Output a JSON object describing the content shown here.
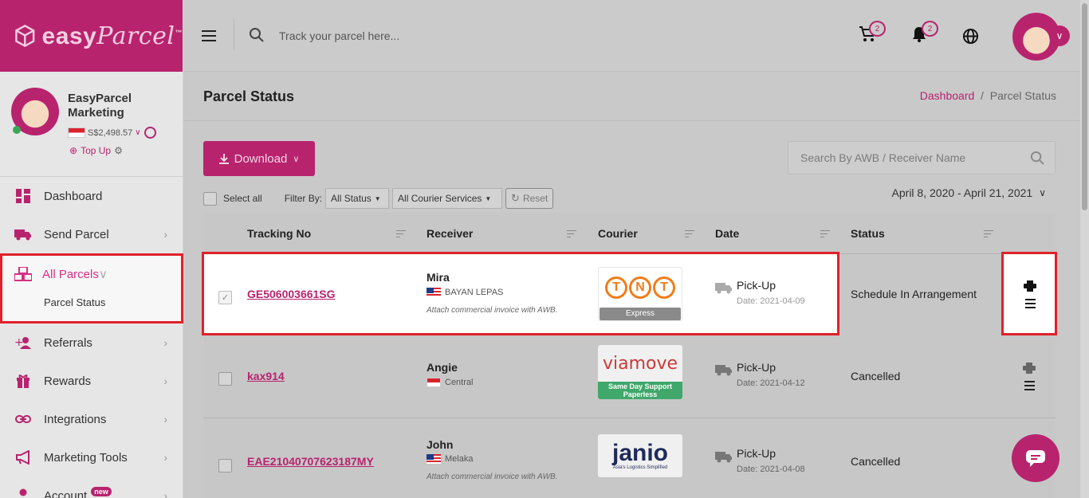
{
  "app": {
    "logo_text": "easy",
    "logo_script": "Parcel",
    "logo_tm": "™"
  },
  "sidebar": {
    "profile": {
      "name": "EasyParcel Marketing",
      "balance": "S$2,498.57",
      "topup_label": "Top Up"
    },
    "items": [
      {
        "label": "Dashboard",
        "icon": "dashboard-icon"
      },
      {
        "label": "Send Parcel",
        "icon": "truck-icon"
      },
      {
        "label": "All Parcels",
        "icon": "boxes-icon",
        "active": true,
        "sub": [
          "Parcel Status"
        ]
      },
      {
        "label": "Referrals",
        "icon": "user-plus-icon"
      },
      {
        "label": "Rewards",
        "icon": "gift-icon"
      },
      {
        "label": "Integrations",
        "icon": "link-icon"
      },
      {
        "label": "Marketing Tools",
        "icon": "megaphone-icon"
      },
      {
        "label": "Account",
        "icon": "user-icon",
        "badge": "new"
      }
    ]
  },
  "topbar": {
    "search_placeholder": "Track your parcel here...",
    "cart_count": "2",
    "notif_count": "2"
  },
  "page": {
    "title": "Parcel Status",
    "breadcrumb": [
      "Dashboard",
      "Parcel Status"
    ],
    "download_label": "Download",
    "search_placeholder": "Search By AWB / Receiver Name",
    "select_all": "Select all",
    "filter_by": "Filter By:",
    "status_filter": "All Status",
    "courier_filter": "All Courier Services",
    "reset_label": "Reset",
    "date_range": "April 8, 2020 - April 21, 2021"
  },
  "table": {
    "columns": [
      "Tracking No",
      "Receiver",
      "Courier",
      "Date",
      "Status"
    ],
    "rows": [
      {
        "tracking": "GE506003661SG",
        "receiver": "Mira",
        "location": "BAYAN LEPAS",
        "note": "Attach commercial invoice with AWB.",
        "courier": "TNT",
        "courier_sub": "Express",
        "date_type": "Pick-Up",
        "date": "Date: 2021-04-09",
        "status": "Schedule In Arrangement",
        "checked": true
      },
      {
        "tracking": "kax914",
        "receiver": "Angie",
        "location": "Central",
        "note": "",
        "courier": "viamove",
        "courier_sub": "Same Day Support Paperless",
        "date_type": "Pick-Up",
        "date": "Date: 2021-04-12",
        "status": "Cancelled",
        "checked": false
      },
      {
        "tracking": "EAE21040707623187MY",
        "receiver": "John",
        "location": "Melaka",
        "note": "Attach commercial invoice with AWB.",
        "courier": "janio",
        "courier_sub": "Asia's Logistics Simplified",
        "date_type": "Pick-Up",
        "date": "Date: 2021-04-08",
        "status": "Cancelled",
        "checked": false
      }
    ]
  },
  "colors": {
    "brand": "#b8236e",
    "highlight": "#e0212a"
  }
}
